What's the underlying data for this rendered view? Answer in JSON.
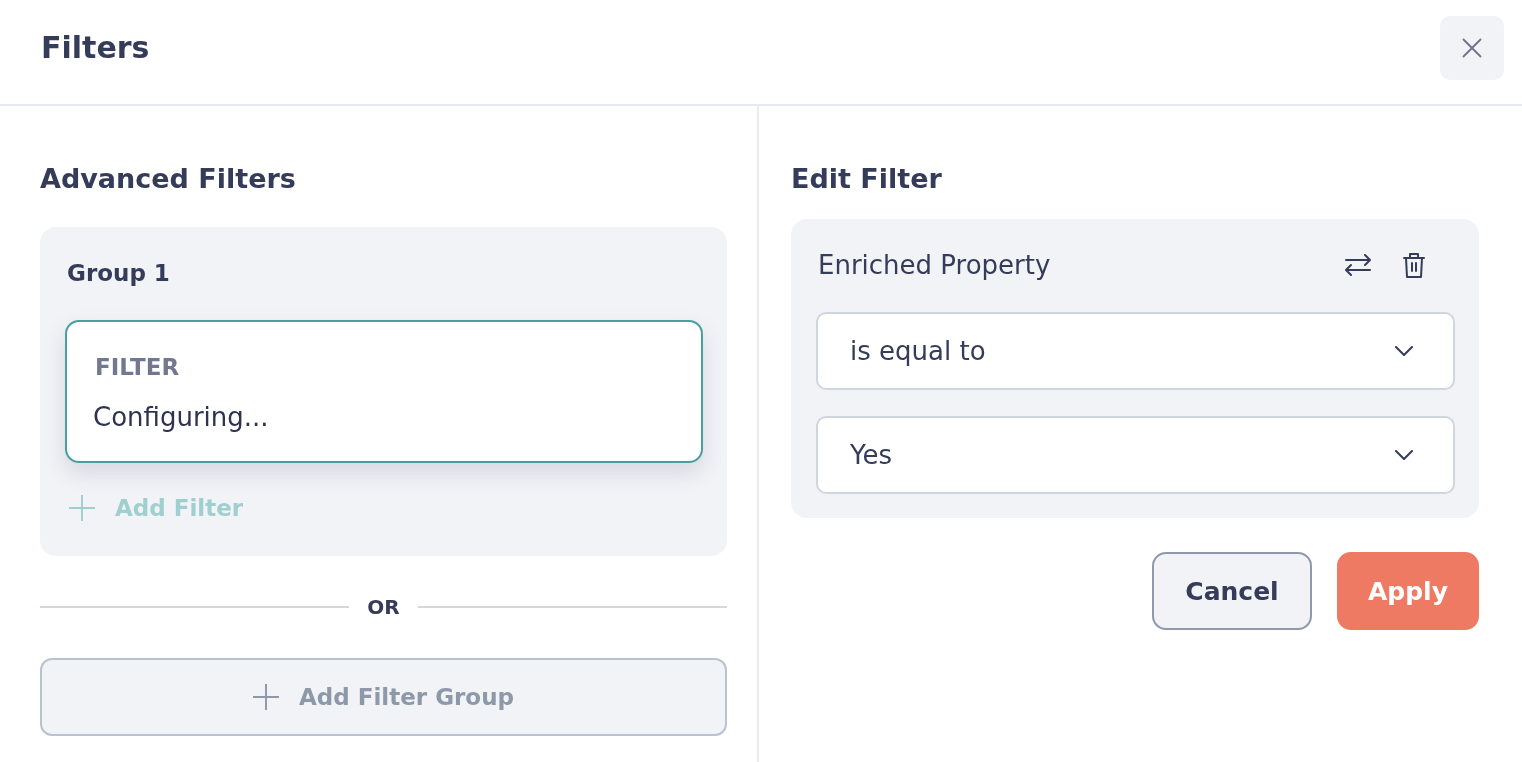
{
  "dialog": {
    "title": "Filters"
  },
  "advanced_filters": {
    "heading": "Advanced Filters",
    "groups": [
      {
        "title": "Group 1",
        "filters": [
          {
            "label": "FILTER",
            "value": "Configuring...",
            "selected": true
          }
        ],
        "add_filter": {
          "label": "Add Filter",
          "disabled": true
        }
      }
    ],
    "separator": "OR",
    "add_group": {
      "label": "Add Filter Group"
    }
  },
  "edit_filter": {
    "heading": "Edit Filter",
    "property": "Enriched Property",
    "selects": [
      {
        "value": "is equal to"
      },
      {
        "value": "Yes"
      }
    ],
    "buttons": [
      {
        "label": "Cancel",
        "kind": "secondary"
      },
      {
        "label": "Apply",
        "kind": "primary"
      }
    ]
  }
}
